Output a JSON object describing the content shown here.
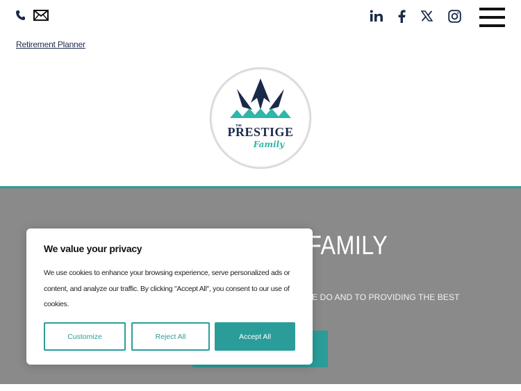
{
  "header": {
    "contact_icons": [
      "phone-icon",
      "mail-icon"
    ],
    "social_icons": [
      "linkedin-icon",
      "facebook-icon",
      "x-twitter-icon",
      "instagram-icon"
    ],
    "menu_icon": "hamburger-menu-icon",
    "link_label": "Retirement Planner"
  },
  "logo": {
    "line1": "THE",
    "line2": "PRESTIGE",
    "line3": "Family"
  },
  "hero": {
    "title": "THE PRESTIGE FAMILY",
    "text": "WE ARE COMMITTED TO EXCELLENCE IN EVERYTHING WE DO AND TO PROVIDING THE BEST"
  },
  "cookie": {
    "title": "We value your privacy",
    "text": "We use cookies to enhance your browsing experience, serve personalized ads or content, and analyze our traffic. By clicking \"Accept All\", you consent to our use of cookies.",
    "customize_label": "Customize",
    "reject_label": "Reject All",
    "accept_label": "Accept All"
  },
  "colors": {
    "accent": "#2a9d9a",
    "navy": "#1b2a4a",
    "hero_bg": "#8a8a8a"
  }
}
